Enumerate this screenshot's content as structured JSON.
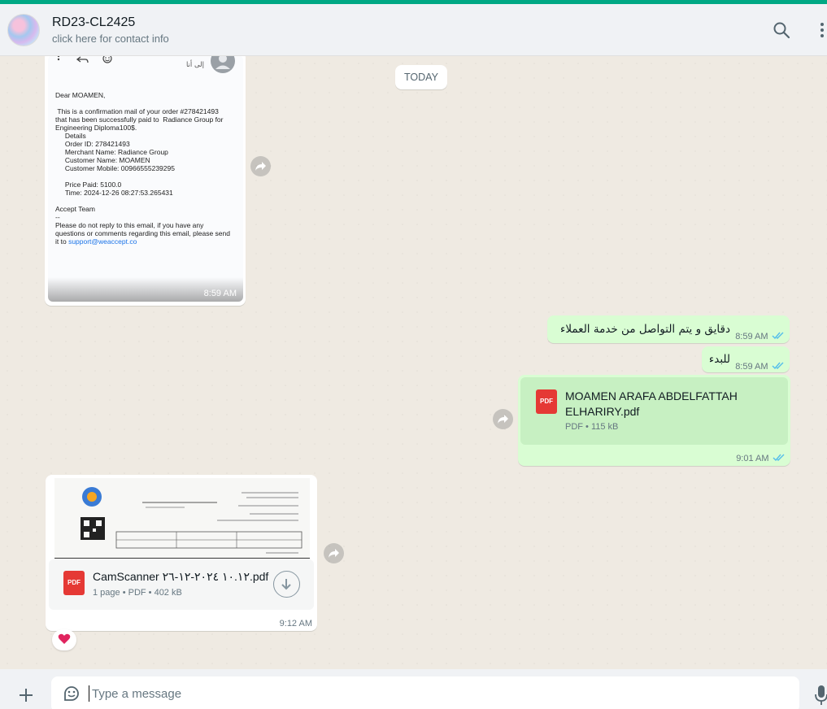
{
  "header": {
    "contact_name": "RD23-CL2425",
    "contact_subtitle": "click here for contact info",
    "accent_color": "#00a884",
    "icons": [
      "search-icon",
      "menu-icon"
    ]
  },
  "chat": {
    "date_chip": "TODAY",
    "email_message": {
      "greeting": "Dear MOAMEN,",
      "body": " This is a confirmation mail of your order #278421493\nthat has been successfully paid to  Radiance Group for\nEngineering Diploma100$.",
      "details": "     Details\n     Order ID: 278421493\n     Merchant Name: Radiance Group\n     Customer Name: MOAMEN\n     Customer Mobile: 00966555239295\n\n     Price Paid: 5100.0\n     Time: 2024-12-26 08:27:53.265431",
      "signoff": "Accept Team\n--\nPlease do not reply to this email, if you have any\nquestions or comments regarding this email, please send\nit to ",
      "support_link": "support@weaccept.co",
      "recipient_label": "إلى أنا",
      "time": "8:59 AM"
    },
    "out_text_1": {
      "text": "دقايق و يتم التواصل من خدمة العملاء",
      "time": "8:59 AM"
    },
    "out_text_2": {
      "text": "للبدء",
      "time": "8:59 AM"
    },
    "out_doc": {
      "icon_label": "PDF",
      "filename": "MOAMEN ARAFA ABDELFATTAH ELHARIRY.pdf",
      "meta": "PDF • 115 kB",
      "time": "9:01 AM"
    },
    "in_doc": {
      "icon_label": "PDF",
      "filename": "CamScanner ١٠.١٢ ٢٠٢٤-١٢-٢٦.pdf",
      "meta": "1 page • PDF • 402 kB",
      "time": "9:12 AM",
      "reaction": "❤️"
    },
    "colors": {
      "outgoing_bubble": "#d9fdd3",
      "incoming_bubble": "#ffffff",
      "read_ticks": "#53bdeb",
      "pdf_red": "#e53935"
    }
  },
  "composer": {
    "placeholder": "Type a message",
    "icons": [
      "plus-icon",
      "sticker-icon",
      "mic-icon"
    ]
  }
}
